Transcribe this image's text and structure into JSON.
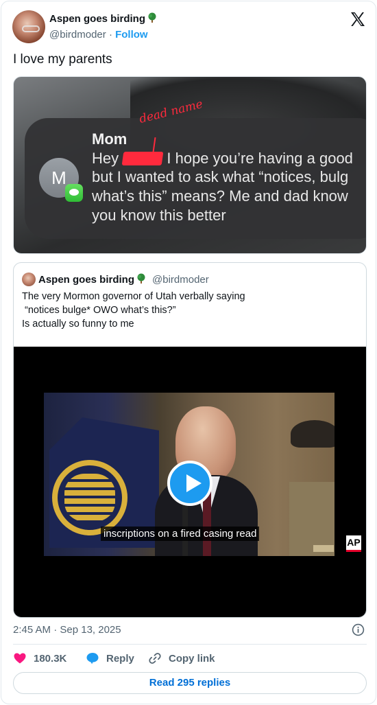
{
  "author": {
    "display_name": "Aspen goes birding",
    "emoji_icon": "deciduous-tree-icon",
    "handle": "@birdmoder",
    "separator": "·",
    "follow_label": "Follow"
  },
  "tweet_text": "I love my parents",
  "photo": {
    "sender": "Mom",
    "lines": [
      "Hey",
      "I hope you’re having a good",
      "but I wanted to ask what “notices, bulg",
      "what’s this” means? Me and dad know",
      "you know this better"
    ],
    "contact_initial": "M",
    "annotation": "dead name"
  },
  "quote": {
    "display_name": "Aspen goes birding",
    "handle": "@birdmoder",
    "text_lines": [
      "The very Mormon governor of Utah verbally saying",
      " “notices bulge* OWO what’s this?”",
      "Is actually so funny to me"
    ],
    "video": {
      "caption": "inscriptions on a fired casing read",
      "logo": "AP"
    }
  },
  "timestamp": "2:45 AM · Sep 13, 2025",
  "actions": {
    "likes": "180.3K",
    "reply_label": "Reply",
    "copy_label": "Copy link"
  },
  "read_replies": "Read 295 replies",
  "colors": {
    "accent": "#1d9bf0",
    "like": "#f91880",
    "link": "#006fd6",
    "redaction": "#ff2a3d"
  }
}
